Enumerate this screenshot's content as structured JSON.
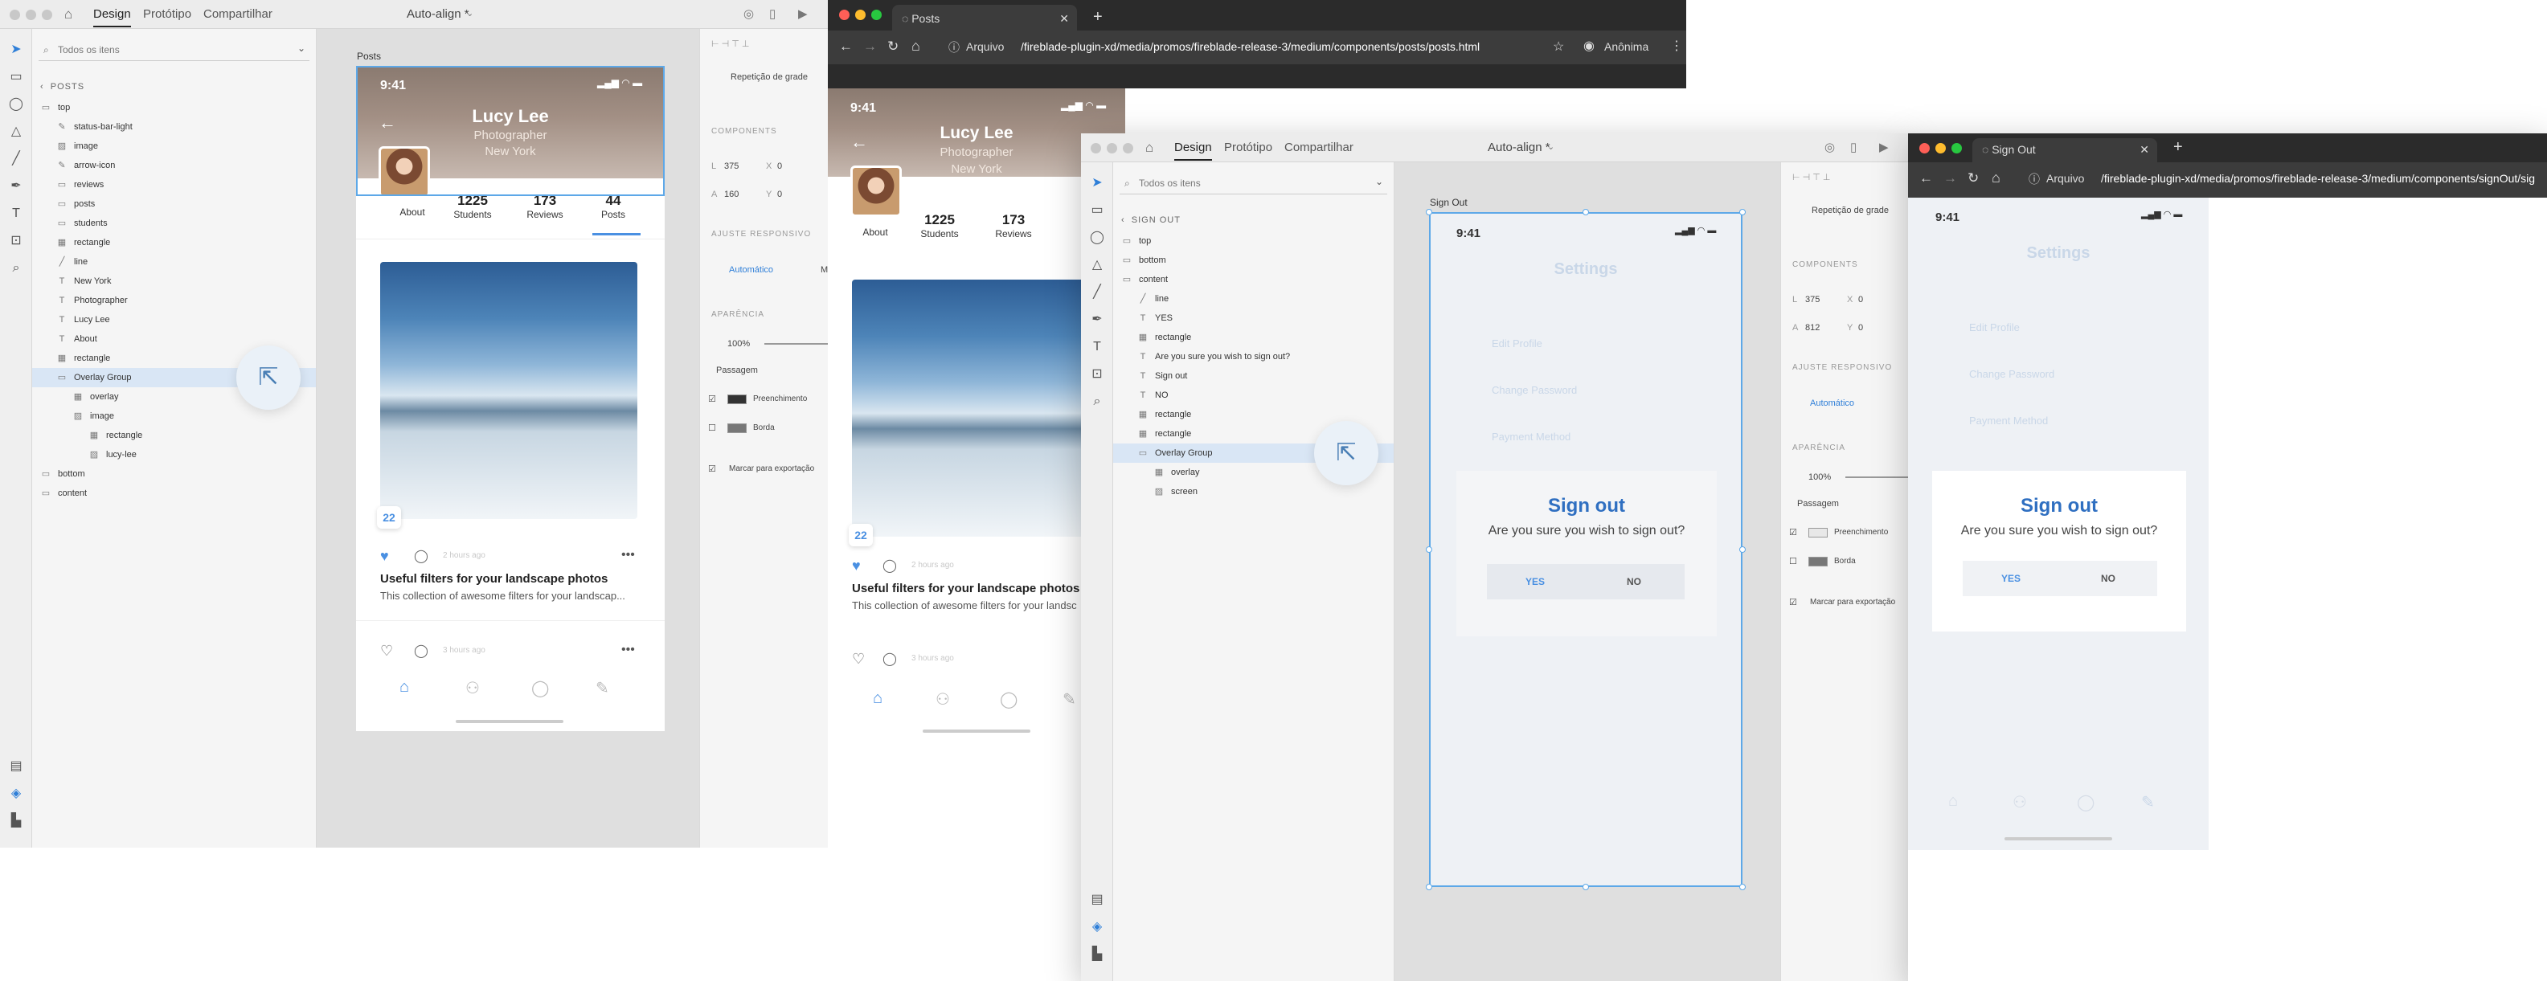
{
  "xd1": {
    "tabs": [
      "Design",
      "Protótipo",
      "Compartilhar"
    ],
    "title": "Auto-align *",
    "search_placeholder": "Todos os itens",
    "breadcrumb": "POSTS",
    "layers": [
      {
        "label": "top",
        "icon": "folder-icon"
      },
      {
        "label": "status-bar-light",
        "icon": "pen-icon"
      },
      {
        "label": "image",
        "icon": "image-icon"
      },
      {
        "label": "arrow-icon",
        "icon": "pen-icon"
      },
      {
        "label": "reviews",
        "icon": "folder-icon"
      },
      {
        "label": "posts",
        "icon": "folder-icon"
      },
      {
        "label": "students",
        "icon": "folder-icon"
      },
      {
        "label": "rectangle",
        "icon": "rect-icon"
      },
      {
        "label": "line",
        "icon": "line-icon"
      },
      {
        "label": "New York",
        "icon": "text-icon"
      },
      {
        "label": "Photographer",
        "icon": "text-icon"
      },
      {
        "label": "Lucy Lee",
        "icon": "text-icon"
      },
      {
        "label": "About",
        "icon": "text-icon"
      },
      {
        "label": "rectangle",
        "icon": "rect-icon"
      },
      {
        "label": "Overlay Group",
        "icon": "folder-icon"
      },
      {
        "label": "overlay",
        "icon": "rect-icon"
      },
      {
        "label": "image",
        "icon": "image-icon"
      },
      {
        "label": "rectangle",
        "icon": "rect-icon"
      },
      {
        "label": "lucy-lee",
        "icon": "image-icon"
      },
      {
        "label": "bottom",
        "icon": "folder-icon"
      },
      {
        "label": "content",
        "icon": "folder-icon"
      }
    ],
    "artboard_label": "Posts",
    "props": {
      "grid_repeat": "Repetição de grade",
      "components": "COMPONENTS",
      "w": "375",
      "x": "0",
      "h": "160",
      "y": "0",
      "responsive": "AJUSTE RESPONSIVO",
      "auto": "Automático",
      "auto_m": "M",
      "appearance": "APARÊNCIA",
      "opacity": "100%",
      "blend": "Passagem",
      "fill": "Preenchimento",
      "border": "Borda",
      "export": "Marcar para exportação"
    }
  },
  "profile": {
    "time": "9:41",
    "name": "Lucy Lee",
    "role": "Photographer",
    "city": "New York",
    "about": "About",
    "students_n": "1225",
    "students": "Students",
    "reviews_n": "173",
    "reviews": "Reviews",
    "posts_n": "44",
    "posts": "Posts",
    "posts_n_cut": "4",
    "posts_cut": "P",
    "badge": "22",
    "time_ago": "2 hours ago",
    "time_ago2": "3 hours ago",
    "card_title": "Useful filters for your landscape photos",
    "card_desc": "This collection of awesome filters for your landscap...",
    "card_desc_cut": "This collection of awesome filters for your landsc"
  },
  "chrome1": {
    "tab": "Posts",
    "scheme": "Arquivo",
    "url": "/fireblade-plugin-xd/media/promos/fireblade-release-3/medium/components/posts/posts.html",
    "profile": "Anônima"
  },
  "xd2": {
    "tabs": [
      "Design",
      "Protótipo",
      "Compartilhar"
    ],
    "title": "Auto-align *",
    "search_placeholder": "Todos os itens",
    "breadcrumb": "SIGN OUT",
    "layers": [
      {
        "label": "top",
        "icon": "folder-icon"
      },
      {
        "label": "bottom",
        "icon": "folder-icon"
      },
      {
        "label": "content",
        "icon": "folder-icon"
      },
      {
        "label": "line",
        "icon": "line-icon"
      },
      {
        "label": "YES",
        "icon": "text-icon"
      },
      {
        "label": "rectangle",
        "icon": "rect-icon"
      },
      {
        "label": "Are you sure you wish to sign out?",
        "icon": "text-icon"
      },
      {
        "label": "Sign out",
        "icon": "text-icon"
      },
      {
        "label": "NO",
        "icon": "text-icon"
      },
      {
        "label": "rectangle",
        "icon": "rect-icon"
      },
      {
        "label": "rectangle",
        "icon": "rect-icon"
      },
      {
        "label": "Overlay Group",
        "icon": "folder-icon"
      },
      {
        "label": "overlay",
        "icon": "rect-icon"
      },
      {
        "label": "screen",
        "icon": "image-icon"
      }
    ],
    "artboard_label": "Sign Out",
    "props": {
      "grid_repeat": "Repetição de grade",
      "components": "COMPONENTS",
      "w": "375",
      "x": "0",
      "h": "812",
      "y": "0",
      "responsive": "AJUSTE RESPONSIVO",
      "auto": "Automático",
      "appearance": "APARÊNCIA",
      "opacity": "100%",
      "blend": "Passagem",
      "fill": "Preenchimento",
      "border": "Borda",
      "export": "Marcar para exportação"
    }
  },
  "signout": {
    "time": "9:41",
    "heading": "Settings",
    "items": [
      "Edit Profile",
      "Change Password",
      "Payment Method"
    ],
    "title": "Sign out",
    "message": "Are you sure you wish to sign out?",
    "yes": "YES",
    "no": "NO"
  },
  "chrome2": {
    "tab": "Sign Out",
    "scheme": "Arquivo",
    "url": "/fireblade-plugin-xd/media/promos/fireblade-release-3/medium/components/signOut/sig"
  },
  "colors": {
    "accent": "#4a90e2",
    "selection": "#5da8e8",
    "dialog_title": "#2f6fc1"
  }
}
